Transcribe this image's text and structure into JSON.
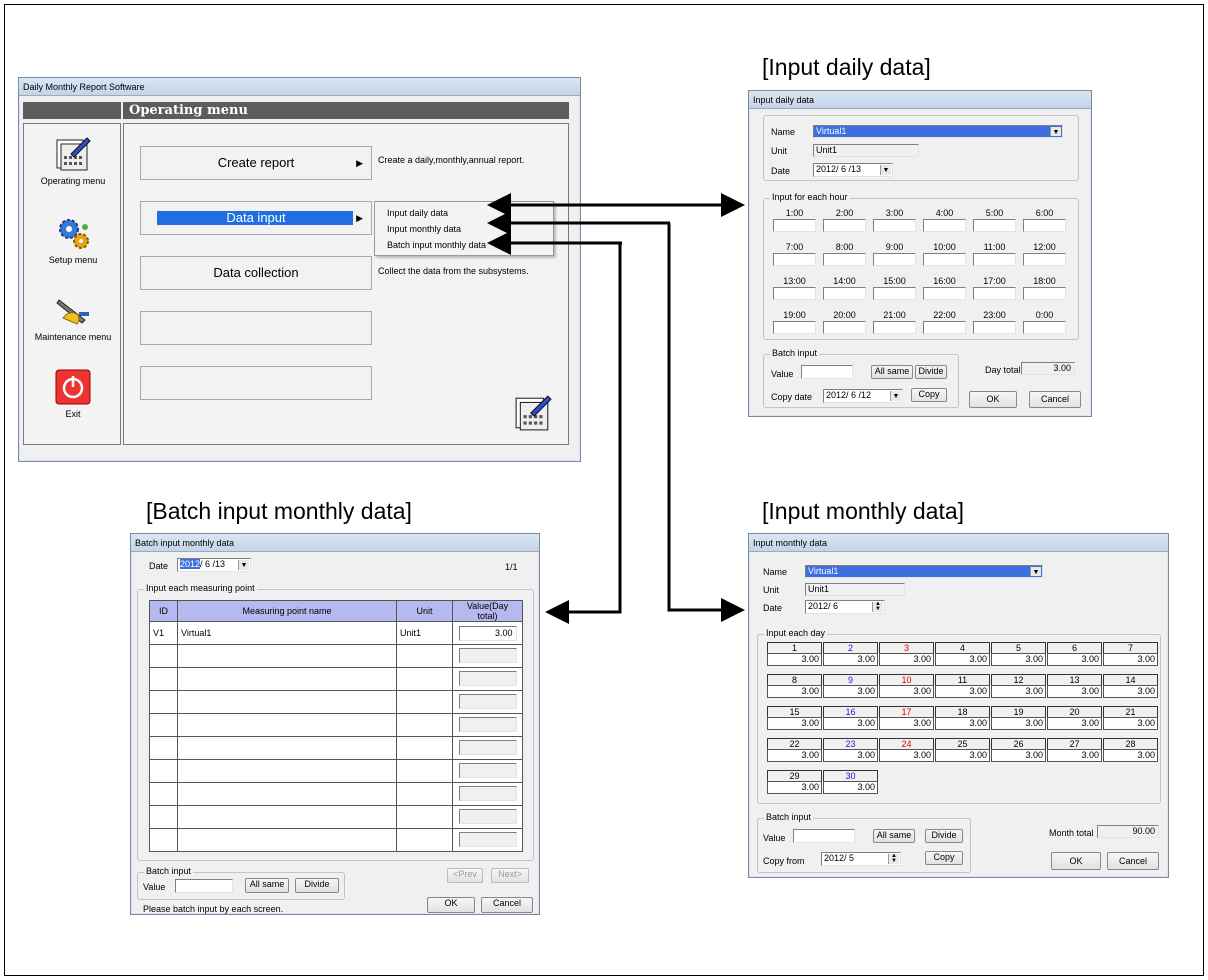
{
  "headings": {
    "daily": "[Input daily data]",
    "batch": "[Batch input monthly data]",
    "monthly": "[Input monthly data]"
  },
  "main_window": {
    "title": "Daily Monthly Report Software",
    "menu_header": "Operating menu",
    "sidebar": [
      {
        "label": "Operating menu",
        "icon": "calendar-icon"
      },
      {
        "label": "Setup menu",
        "icon": "gears-icon"
      },
      {
        "label": "Maintenance menu",
        "icon": "tools-icon"
      },
      {
        "label": "Exit",
        "icon": "power-icon"
      }
    ],
    "buttons": {
      "create_report": "Create report",
      "data_input": "Data input",
      "data_collection": "Data collection"
    },
    "descriptions": {
      "create_report": "Create a daily,monthly,annual report.",
      "data_collection": "Collect the data from the subsystems."
    },
    "submenu": [
      "Input daily data",
      "Input monthly data",
      "Batch input monthly data"
    ]
  },
  "daily_window": {
    "title": "Input daily data",
    "name_label": "Name",
    "name_value": "Virtual1",
    "unit_label": "Unit",
    "unit_value": "Unit1",
    "date_label": "Date",
    "date_value": "2012/ 6 /13",
    "hour_group": "Input for each hour",
    "hours": [
      "1:00",
      "2:00",
      "3:00",
      "4:00",
      "5:00",
      "6:00",
      "7:00",
      "8:00",
      "9:00",
      "10:00",
      "11:00",
      "12:00",
      "13:00",
      "14:00",
      "15:00",
      "16:00",
      "17:00",
      "18:00",
      "19:00",
      "20:00",
      "21:00",
      "22:00",
      "23:00",
      "0:00"
    ],
    "batch_group": "Batch input",
    "value_label": "Value",
    "all_same": "All same",
    "divide": "Divide",
    "copy_date_label": "Copy date",
    "copy_date_value": "2012/ 6 /12",
    "copy": "Copy",
    "day_total_label": "Day total",
    "day_total_value": "3.00",
    "ok": "OK",
    "cancel": "Cancel"
  },
  "monthly_window": {
    "title": "Input monthly data",
    "name_label": "Name",
    "name_value": "Virtual1",
    "unit_label": "Unit",
    "unit_value": "Unit1",
    "date_label": "Date",
    "date_value": "2012/ 6",
    "day_group": "Input each day",
    "days": [
      {
        "d": "1",
        "v": "3.00",
        "c": "#000"
      },
      {
        "d": "2",
        "v": "3.00",
        "c": "#1a1adc"
      },
      {
        "d": "3",
        "v": "3.00",
        "c": "#e00000"
      },
      {
        "d": "4",
        "v": "3.00",
        "c": "#000"
      },
      {
        "d": "5",
        "v": "3.00",
        "c": "#000"
      },
      {
        "d": "6",
        "v": "3.00",
        "c": "#000"
      },
      {
        "d": "7",
        "v": "3.00",
        "c": "#000"
      },
      {
        "d": "8",
        "v": "3.00",
        "c": "#000"
      },
      {
        "d": "9",
        "v": "3.00",
        "c": "#1a1adc"
      },
      {
        "d": "10",
        "v": "3.00",
        "c": "#e00000"
      },
      {
        "d": "11",
        "v": "3.00",
        "c": "#000"
      },
      {
        "d": "12",
        "v": "3.00",
        "c": "#000"
      },
      {
        "d": "13",
        "v": "3.00",
        "c": "#000"
      },
      {
        "d": "14",
        "v": "3.00",
        "c": "#000"
      },
      {
        "d": "15",
        "v": "3.00",
        "c": "#000"
      },
      {
        "d": "16",
        "v": "3.00",
        "c": "#1a1adc"
      },
      {
        "d": "17",
        "v": "3.00",
        "c": "#e00000"
      },
      {
        "d": "18",
        "v": "3.00",
        "c": "#000"
      },
      {
        "d": "19",
        "v": "3.00",
        "c": "#000"
      },
      {
        "d": "20",
        "v": "3.00",
        "c": "#000"
      },
      {
        "d": "21",
        "v": "3.00",
        "c": "#000"
      },
      {
        "d": "22",
        "v": "3.00",
        "c": "#000"
      },
      {
        "d": "23",
        "v": "3.00",
        "c": "#1a1adc"
      },
      {
        "d": "24",
        "v": "3.00",
        "c": "#e00000"
      },
      {
        "d": "25",
        "v": "3.00",
        "c": "#000"
      },
      {
        "d": "26",
        "v": "3.00",
        "c": "#000"
      },
      {
        "d": "27",
        "v": "3.00",
        "c": "#000"
      },
      {
        "d": "28",
        "v": "3.00",
        "c": "#000"
      },
      {
        "d": "29",
        "v": "3.00",
        "c": "#000"
      },
      {
        "d": "30",
        "v": "3.00",
        "c": "#1a1adc"
      }
    ],
    "batch_group": "Batch input",
    "value_label": "Value",
    "all_same": "All same",
    "divide": "Divide",
    "copy_from_label": "Copy from",
    "copy_from_value": "2012/ 5",
    "copy": "Copy",
    "month_total_label": "Month total",
    "month_total_value": "90.00",
    "ok": "OK",
    "cancel": "Cancel"
  },
  "batch_window": {
    "title": "Batch input monthly data",
    "date_label": "Date",
    "date_value_sel": "2012",
    "date_value_rest": "/ 6 /13",
    "page": "1/1",
    "group": "Input each measuring point",
    "columns": [
      "ID",
      "Measuring point name",
      "Unit",
      "Value(Day total)"
    ],
    "rows": [
      {
        "id": "V1",
        "name": "Virtual1",
        "unit": "Unit1",
        "value": "3.00"
      },
      {
        "id": "",
        "name": "",
        "unit": "",
        "value": ""
      },
      {
        "id": "",
        "name": "",
        "unit": "",
        "value": ""
      },
      {
        "id": "",
        "name": "",
        "unit": "",
        "value": ""
      },
      {
        "id": "",
        "name": "",
        "unit": "",
        "value": ""
      },
      {
        "id": "",
        "name": "",
        "unit": "",
        "value": ""
      },
      {
        "id": "",
        "name": "",
        "unit": "",
        "value": ""
      },
      {
        "id": "",
        "name": "",
        "unit": "",
        "value": ""
      },
      {
        "id": "",
        "name": "",
        "unit": "",
        "value": ""
      },
      {
        "id": "",
        "name": "",
        "unit": "",
        "value": ""
      }
    ],
    "batch_group": "Batch input",
    "value_label": "Value",
    "all_same": "All same",
    "divide": "Divide",
    "prev": "<Prev",
    "next": "Next>",
    "ok": "OK",
    "cancel": "Cancel",
    "note": "Please batch input by each screen."
  }
}
